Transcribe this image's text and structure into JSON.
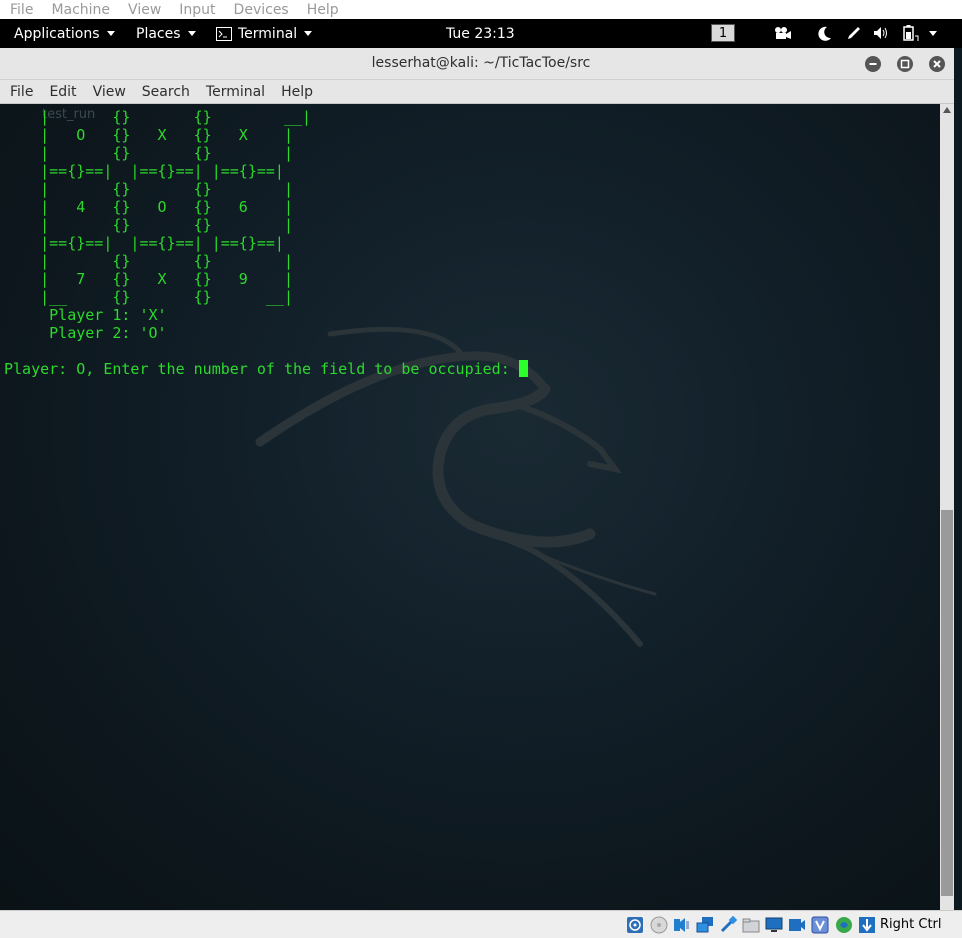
{
  "vbox_menu": [
    "File",
    "Machine",
    "View",
    "Input",
    "Devices",
    "Help"
  ],
  "panel": {
    "applications": "Applications",
    "places": "Places",
    "terminal": "Terminal",
    "clock": "Tue 23:13",
    "workspace": "1"
  },
  "window": {
    "title": "lesserhat@kali: ~/TicTacToe/src",
    "menu": [
      "File",
      "Edit",
      "View",
      "Search",
      "Terminal",
      "Help"
    ]
  },
  "terminal": {
    "ghost_label": "test_run",
    "lines": [
      "    |       {}       {}        __|",
      "    |   O   {}   X   {}   X    |",
      "    |       {}       {}        |",
      "    |=={}==|  |=={}==| |=={}==|",
      "    |       {}       {}        |",
      "    |   4   {}   O   {}   6    |",
      "    |       {}       {}        |",
      "    |=={}==|  |=={}==| |=={}==|",
      "    |       {}       {}        |",
      "    |   7   {}   X   {}   9    |",
      "    |__     {}       {}      __|",
      "     Player 1: 'X'",
      "     Player 2: 'O'",
      ""
    ],
    "prompt": "Player: O, Enter the number of the field to be occupied: "
  },
  "statusbar": {
    "host_key": "Right Ctrl",
    "icons": [
      "optical-drive-icon",
      "floppy-icon",
      "audio-icon",
      "network-icon",
      "usb-icon",
      "shared-folders-icon",
      "display-icon",
      "recording-icon",
      "virtualization-icon",
      "mouse-integration-icon",
      "host-key-arrow-icon"
    ]
  },
  "colors": {
    "terminal_text": "#2cd92c",
    "cursor": "#2cff2c"
  }
}
